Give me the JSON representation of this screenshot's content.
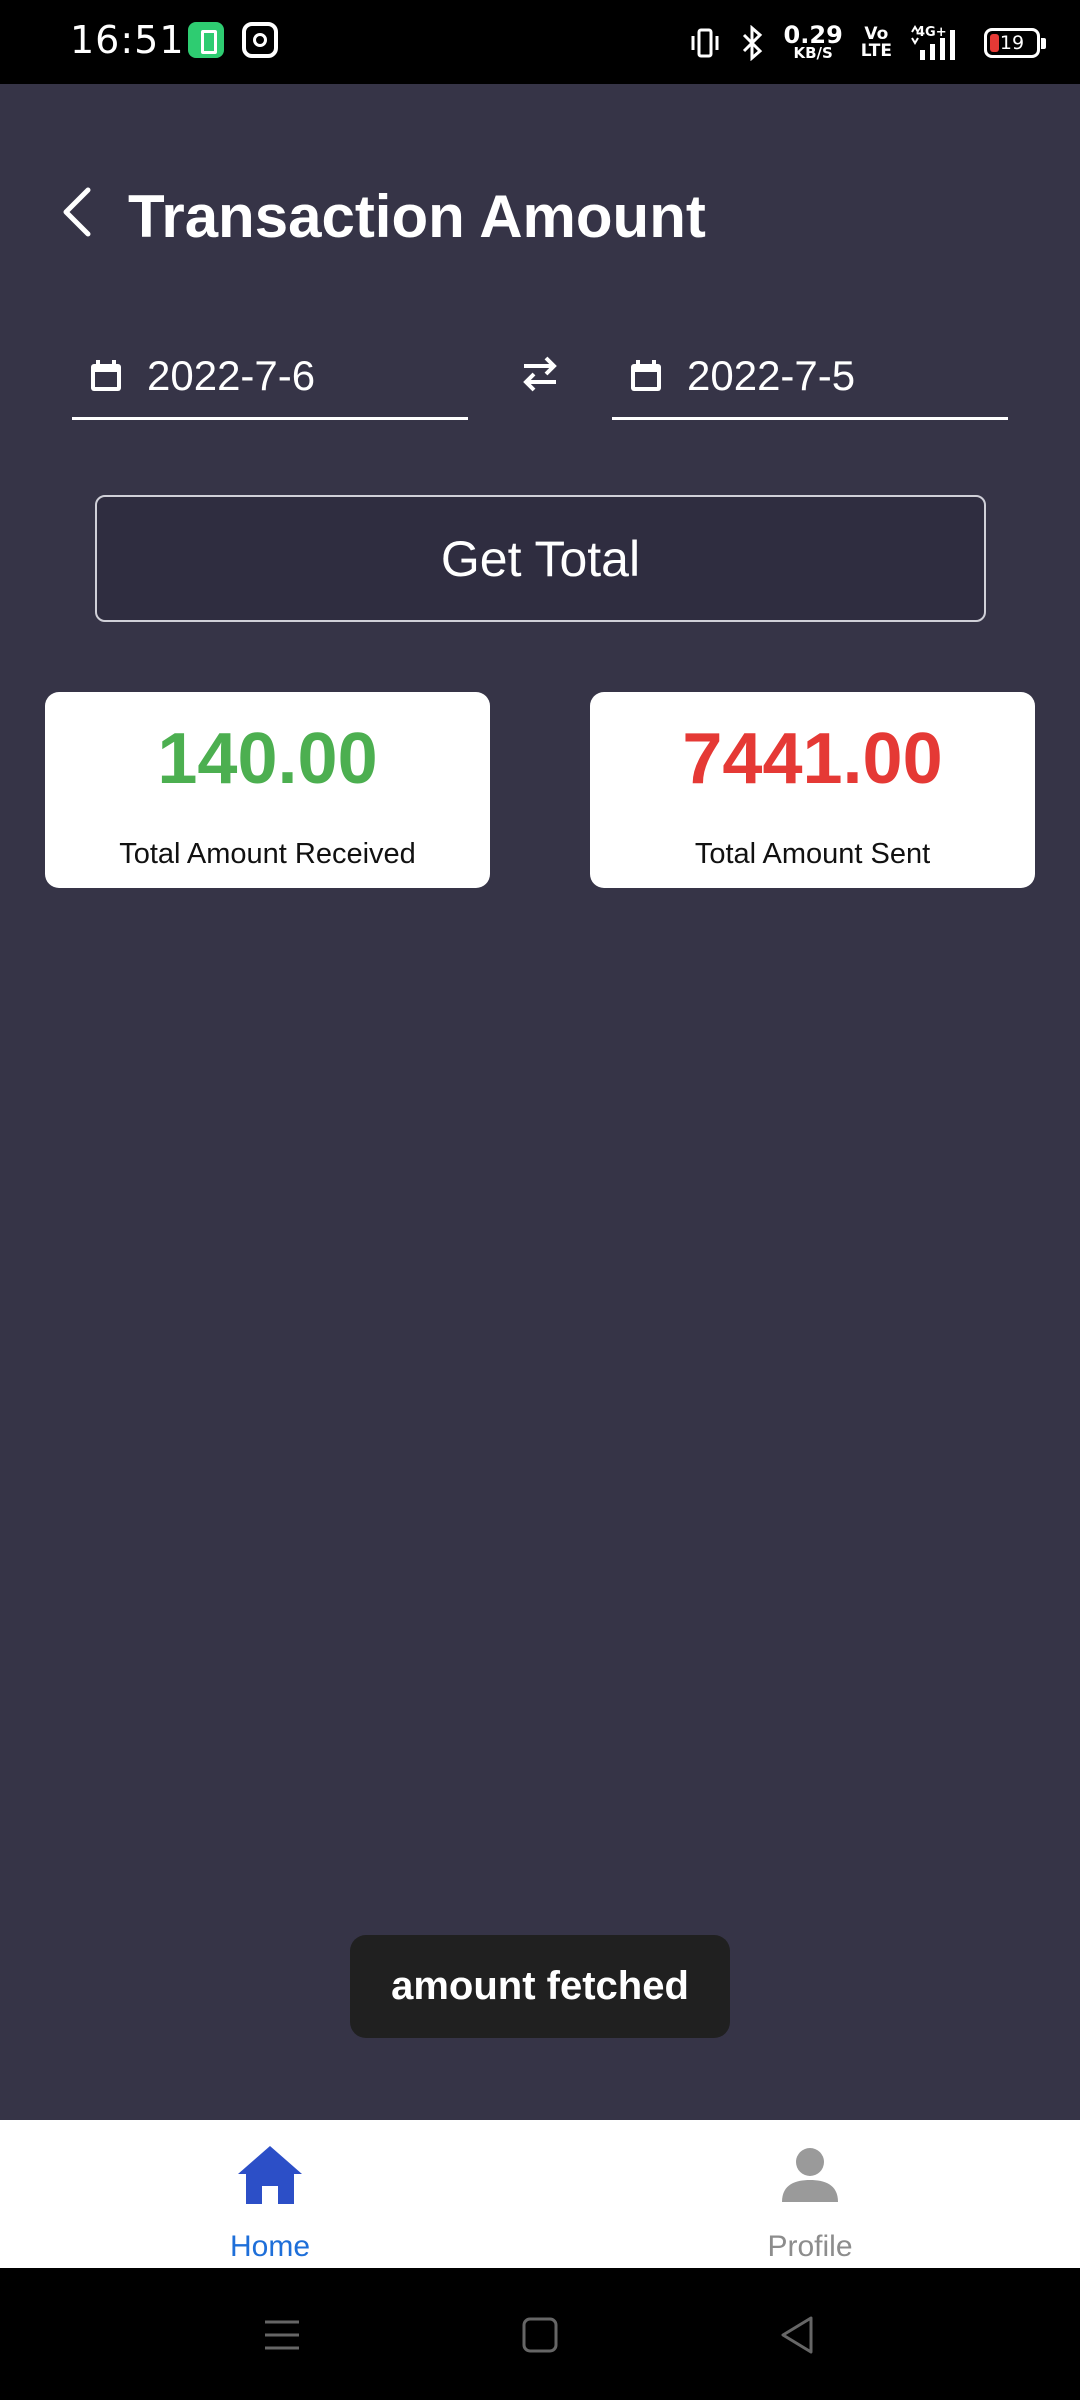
{
  "status_bar": {
    "time": "16:51",
    "net_speed_value": "0.29",
    "net_speed_unit": "KB/S",
    "volte_top": "Vo",
    "volte_bottom": "LTE",
    "network": "4G+",
    "battery_level": "19"
  },
  "header": {
    "title": "Transaction Amount"
  },
  "date_range": {
    "from": "2022-7-6",
    "to": "2022-7-5"
  },
  "actions": {
    "get_total_label": "Get Total"
  },
  "summary": {
    "received": {
      "amount": "140.00",
      "label": "Total Amount Received",
      "color": "#4caf50"
    },
    "sent": {
      "amount": "7441.00",
      "label": "Total Amount Sent",
      "color": "#e53935"
    }
  },
  "toast": {
    "message": "amount fetched"
  },
  "bottom_nav": {
    "items": [
      {
        "label": "Home",
        "icon": "home-icon",
        "active": true,
        "color": "#1e6fd9"
      },
      {
        "label": "Profile",
        "icon": "person-icon",
        "active": false,
        "color": "#8d8d8d"
      }
    ]
  },
  "colors": {
    "background": "#363447",
    "accent": "#1e6fd9"
  }
}
